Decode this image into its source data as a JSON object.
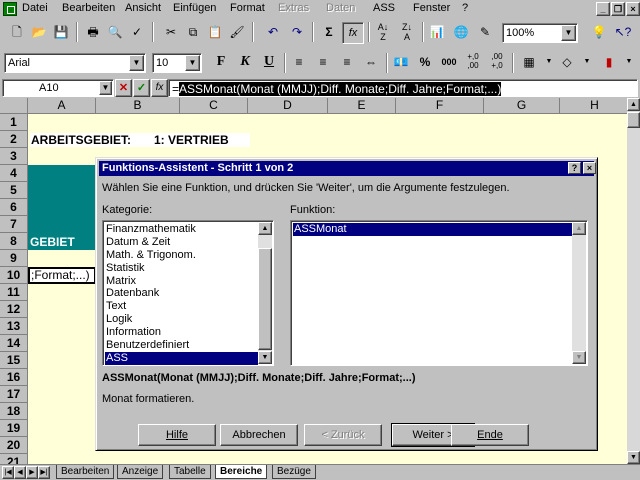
{
  "menubar": {
    "items": [
      {
        "label": "Datei",
        "enabled": true
      },
      {
        "label": "Bearbeiten",
        "enabled": true
      },
      {
        "label": "Ansicht",
        "enabled": true
      },
      {
        "label": "Einfügen",
        "enabled": true
      },
      {
        "label": "Format",
        "enabled": true
      },
      {
        "label": "Extras",
        "enabled": false
      },
      {
        "label": "Daten",
        "enabled": false
      },
      {
        "label": "ASS",
        "enabled": true
      },
      {
        "label": "Fenster",
        "enabled": true
      },
      {
        "label": "?",
        "enabled": true
      }
    ]
  },
  "toolbar": {
    "zoom": "100%",
    "font_name": "Arial",
    "font_size": "10",
    "bold_label": "F",
    "italic_label": "K",
    "underline_label": "U"
  },
  "formula_bar": {
    "name_box": "A10",
    "fx_label": "fx",
    "formula_prefix": "=",
    "formula_selected": "ASSMonat(Monat (MMJJ);Diff. Monate;Diff. Jahre;Format;...)"
  },
  "grid": {
    "columns": [
      "A",
      "B",
      "C",
      "D",
      "E",
      "F",
      "G",
      "H"
    ],
    "rows": [
      "1",
      "2",
      "3",
      "4",
      "5",
      "6",
      "7",
      "8",
      "9",
      "10",
      "11",
      "12",
      "13",
      "14",
      "15",
      "16",
      "17",
      "18",
      "19",
      "20",
      "21"
    ],
    "b2": "ARBEITSGEBIET:",
    "c2": "1: VERTRIEB",
    "a8": "GEBIET",
    "a10": ";Format;...)"
  },
  "sheet_tabs": {
    "tabs": [
      {
        "label": "Bearbeiten",
        "active": false
      },
      {
        "label": "Anzeige",
        "active": false
      },
      {
        "label": "Tabelle",
        "active": false
      },
      {
        "label": "Bereiche",
        "active": true
      },
      {
        "label": "Bezüge",
        "active": false
      }
    ]
  },
  "dialog": {
    "title": "Funktions-Assistent - Schritt 1 von 2",
    "help_btn": "?",
    "close_btn": "×",
    "instruction": "Wählen Sie eine Funktion, und drücken Sie 'Weiter', um die Argumente festzulegen.",
    "category_label": "Kategorie:",
    "function_label": "Funktion:",
    "categories": [
      {
        "label": "Finanzmathematik",
        "selected": false
      },
      {
        "label": "Datum & Zeit",
        "selected": false
      },
      {
        "label": "Math. & Trigonom.",
        "selected": false
      },
      {
        "label": "Statistik",
        "selected": false
      },
      {
        "label": "Matrix",
        "selected": false
      },
      {
        "label": "Datenbank",
        "selected": false
      },
      {
        "label": "Text",
        "selected": false
      },
      {
        "label": "Logik",
        "selected": false
      },
      {
        "label": "Information",
        "selected": false
      },
      {
        "label": "Benutzerdefiniert",
        "selected": false
      },
      {
        "label": "ASS",
        "selected": true
      }
    ],
    "functions": [
      {
        "label": "ASSMonat",
        "selected": true
      }
    ],
    "syntax": "ASSMonat(Monat (MMJJ);Diff. Monate;Diff. Jahre;Format;...)",
    "description": "Monat formatieren.",
    "buttons": {
      "help": "Hilfe",
      "cancel": "Abbrechen",
      "back": "< Zurück",
      "next": "Weiter >",
      "finish": "Ende"
    }
  }
}
